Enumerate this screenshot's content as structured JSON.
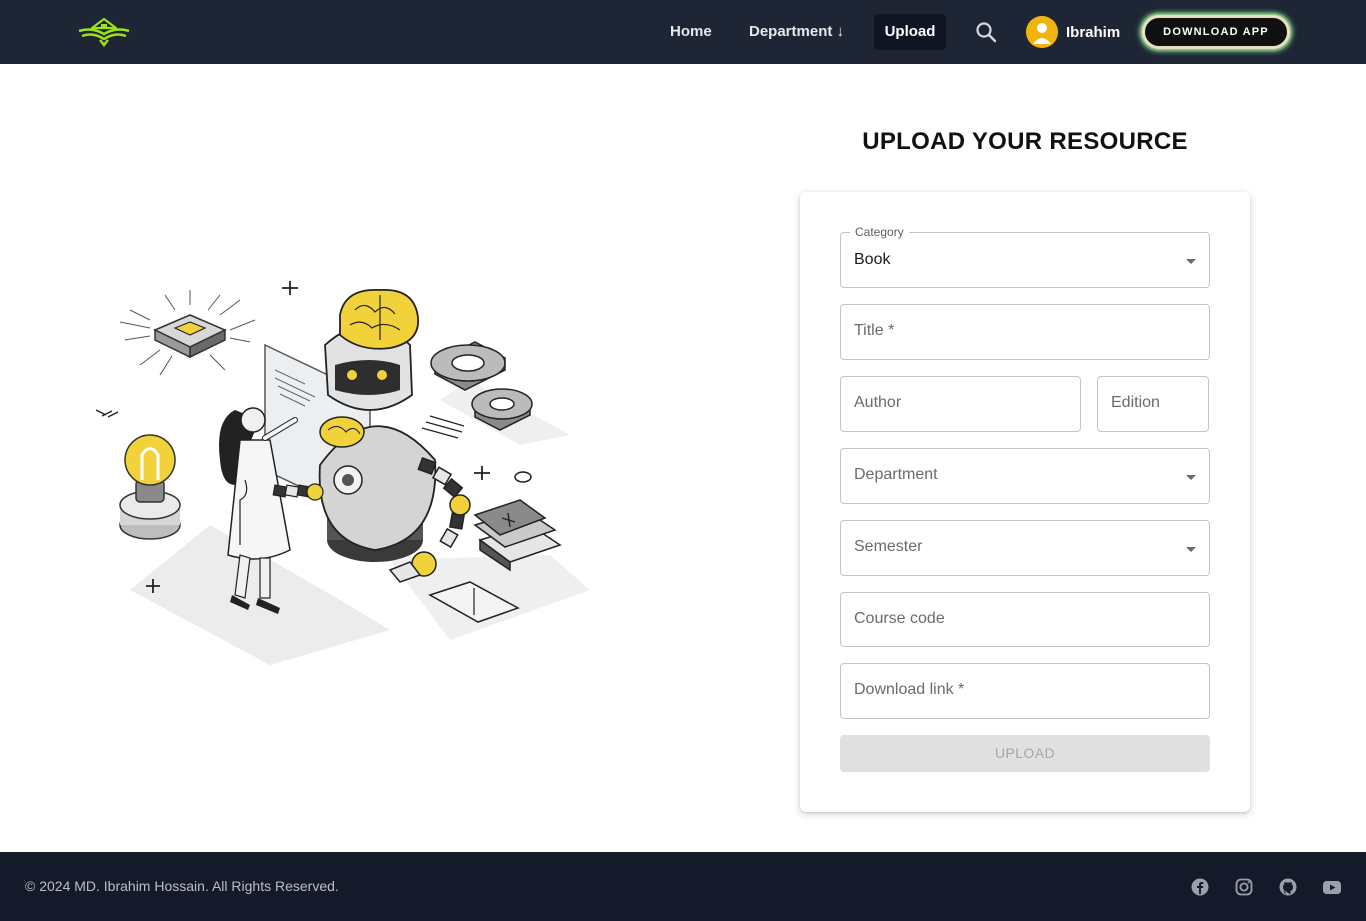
{
  "navbar": {
    "logo": "book-house-logo",
    "links": [
      {
        "label": "Home"
      },
      {
        "label": "Department ↓"
      },
      {
        "label": "Upload",
        "active": true
      }
    ],
    "search_icon": "search-icon",
    "user": {
      "name": "Ibrahim",
      "avatar": "user-avatar-icon"
    },
    "download_app_label": "DOWNLOAD APP"
  },
  "main": {
    "title": "UPLOAD YOUR RESOURCE",
    "illustration": "isometric-ai-robot-and-scientist-illustration",
    "form": {
      "category": {
        "label": "Category",
        "value": "Book"
      },
      "title": {
        "placeholder": "Title *"
      },
      "author": {
        "placeholder": "Author"
      },
      "edition": {
        "placeholder": "Edition"
      },
      "department": {
        "placeholder": "Department"
      },
      "semester": {
        "placeholder": "Semester"
      },
      "course_code": {
        "placeholder": "Course code"
      },
      "download_link": {
        "placeholder": "Download link *"
      },
      "submit_label": "UPLOAD"
    }
  },
  "footer": {
    "copyright": "© 2024 MD. Ibrahim Hossain. All Rights Reserved.",
    "social": [
      "facebook-icon",
      "instagram-icon",
      "github-icon",
      "youtube-icon"
    ]
  },
  "colors": {
    "navbar_bg": "#1e2534",
    "footer_bg": "#141a2a",
    "accent_yellow": "#f2c94c",
    "logo_green": "#9be21c"
  }
}
